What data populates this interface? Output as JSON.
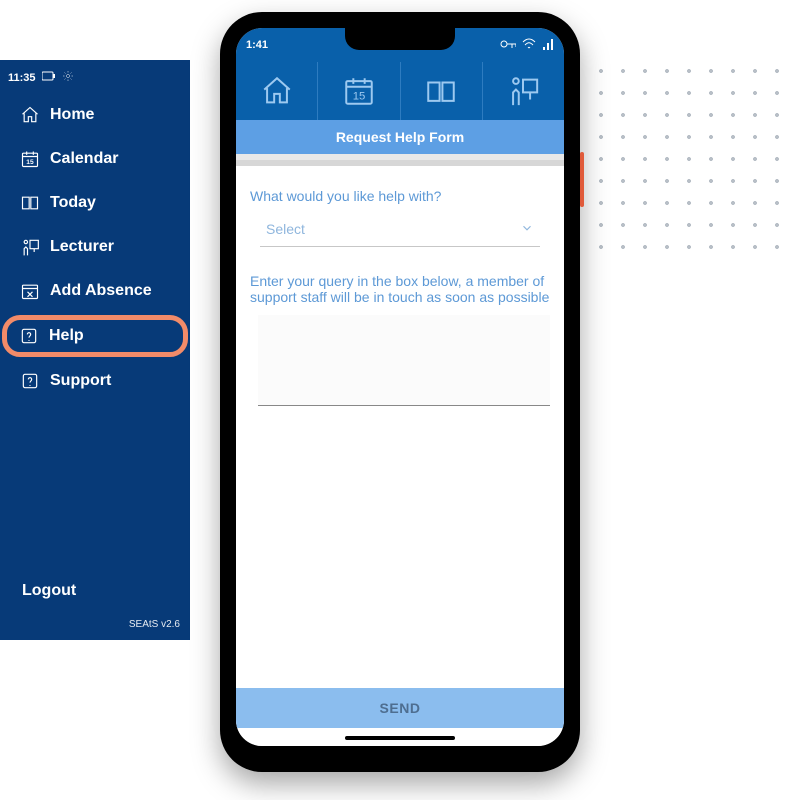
{
  "sidebar": {
    "status_time": "11:35",
    "items": [
      {
        "label": "Home"
      },
      {
        "label": "Calendar"
      },
      {
        "label": "Today"
      },
      {
        "label": "Lecturer"
      },
      {
        "label": "Add Absence"
      },
      {
        "label": "Help"
      },
      {
        "label": "Support"
      }
    ],
    "logout": "Logout",
    "footer": "SEAtS v2.6",
    "highlight_index": 5
  },
  "phone": {
    "status_time": "1:41",
    "toolbar_icons": [
      "home",
      "calendar",
      "book",
      "lecturer"
    ],
    "header": "Request Help Form",
    "form": {
      "q1": "What would you like help with?",
      "select_placeholder": "Select",
      "q2": "Enter your query in the box below, a member of support staff will be in touch as soon as possible",
      "send": "SEND"
    }
  },
  "colors": {
    "brand": "#073a78",
    "accent": "#f28b69",
    "toolbar": "#0960aa",
    "band": "#5d9fe4",
    "light": "#8bbdee"
  }
}
